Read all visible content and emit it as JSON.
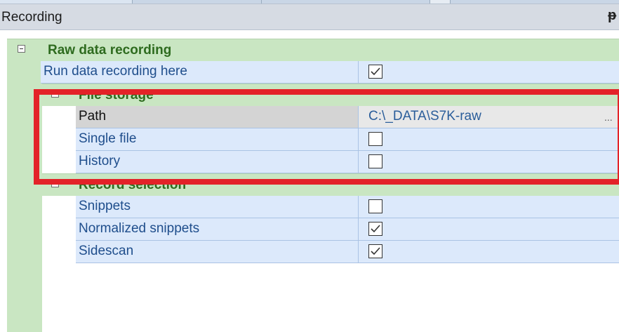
{
  "panel": {
    "title": "Recording",
    "pin_icon": "pin-icon"
  },
  "sections": {
    "raw": {
      "label": "Raw data recording"
    },
    "run_here": {
      "label": "Run data recording here",
      "checked": true
    },
    "file_storage": {
      "label": "File storage"
    },
    "path": {
      "label": "Path",
      "value": "C:\\_DATA\\S7K-raw",
      "browse": "..."
    },
    "single_file": {
      "label": "Single file",
      "checked": false
    },
    "history": {
      "label": "History",
      "checked": false
    },
    "record_selection": {
      "label": "Record selection"
    },
    "snippets": {
      "label": "Snippets",
      "checked": false
    },
    "normalized_snippets": {
      "label": "Normalized snippets",
      "checked": true
    },
    "sidescan": {
      "label": "Sidescan",
      "checked": true
    }
  },
  "colors": {
    "highlight": "#e32228",
    "category_bg": "#c9e6c2",
    "property_bg": "#dce9fb"
  }
}
